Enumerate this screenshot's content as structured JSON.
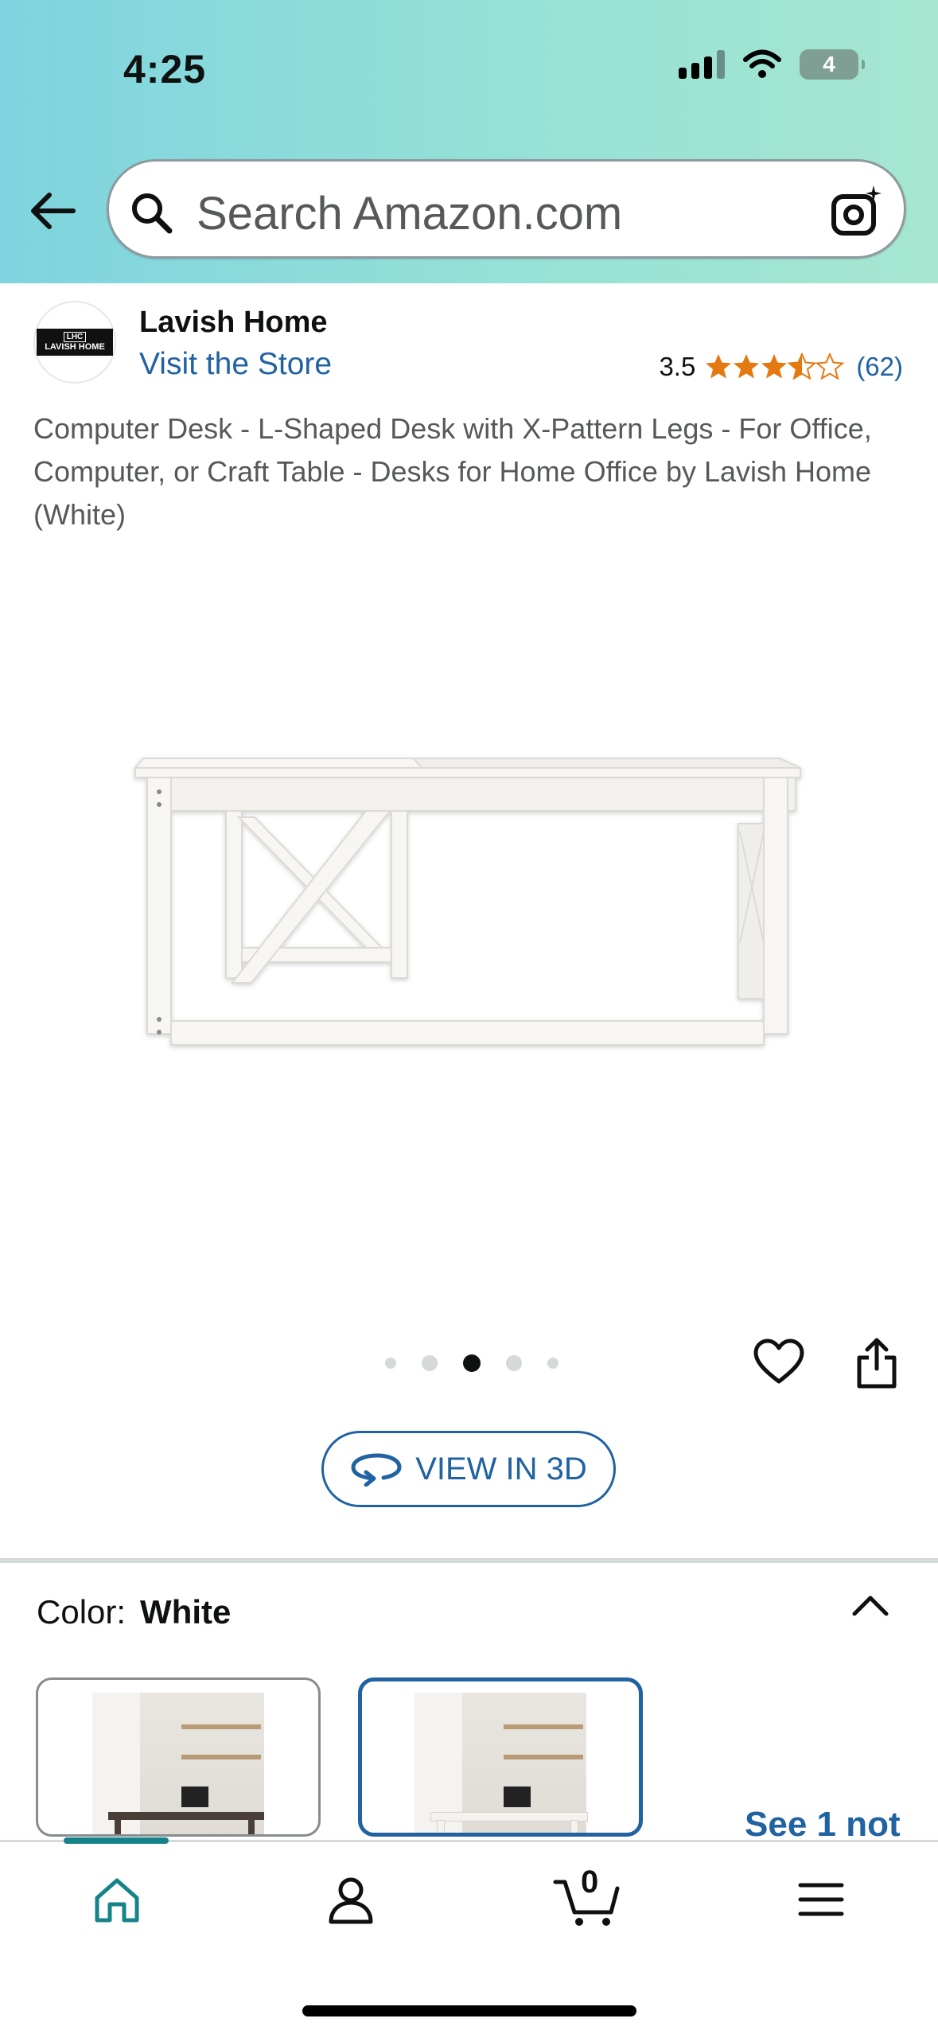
{
  "status_bar": {
    "time": "4:25",
    "battery": "4"
  },
  "search": {
    "placeholder": "Search Amazon.com"
  },
  "store": {
    "name": "Lavish Home",
    "visit_label": "Visit the Store",
    "logo_top": "LHC",
    "logo_text": "LAVISH HOME"
  },
  "rating": {
    "value": "3.5",
    "count": "(62)",
    "stars": 3.5,
    "star_color": "#e47911"
  },
  "product": {
    "title": "Computer Desk - L-Shaped Desk with X-Pattern Legs - For Office, Computer, or Craft Table - Desks for Home Office by Lavish Home (White)"
  },
  "gallery": {
    "dot_count": 5,
    "active_index": 2
  },
  "view3d": {
    "label": "VIEW IN 3D"
  },
  "variation": {
    "label": "Color:",
    "value": "White",
    "see_more": "See 1 not"
  },
  "cart": {
    "count": "0"
  },
  "colors": {
    "link": "#2162a1",
    "accent_teal": "#16838a"
  },
  "icons": [
    "back-arrow-icon",
    "search-icon",
    "camera-search-icon",
    "heart-icon",
    "share-icon",
    "rotate-3d-icon",
    "chevron-up-icon",
    "home-icon",
    "account-icon",
    "cart-icon",
    "menu-icon"
  ]
}
